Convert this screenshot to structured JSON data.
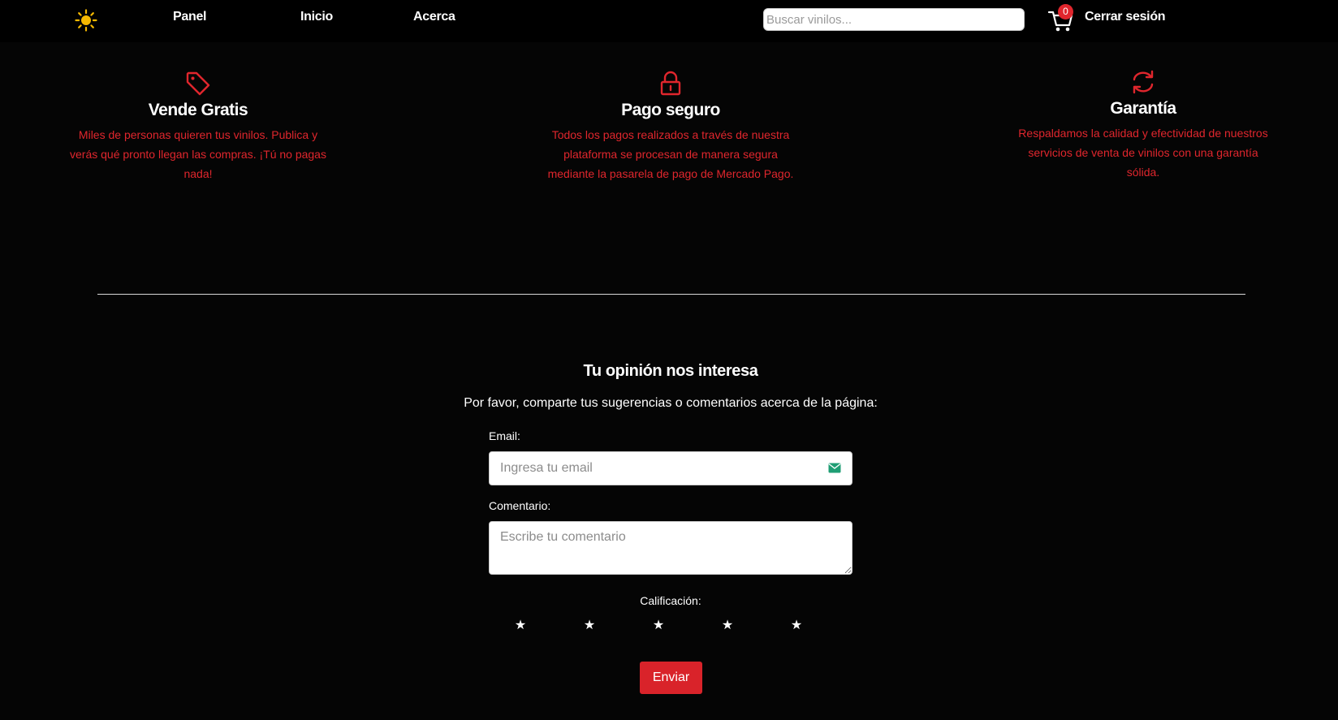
{
  "navbar": {
    "theme_icon": "sun-icon",
    "links": [
      "Panel",
      "Inicio",
      "Acerca"
    ],
    "search_placeholder": "Buscar vinilos...",
    "cart_icon": "shopping-cart-icon",
    "cart_count": "0",
    "logout_label": "Cerrar sesión"
  },
  "features": [
    {
      "icon": "tag-icon",
      "title": "Vende Gratis",
      "text": "Miles de personas quieren tus vinilos. Publica y verás qué pronto llegan las compras. ¡Tú no pagas nada!"
    },
    {
      "icon": "lock-icon",
      "title": "Pago seguro",
      "text": "Todos los pagos realizados a través de nuestra plataforma se procesan de manera segura mediante la pasarela de pago de Mercado Pago."
    },
    {
      "icon": "refresh-icon",
      "title": "Garantía",
      "text": "Respaldamos la calidad y efectividad de nuestros servicios de venta de vinilos con una garantía sólida."
    }
  ],
  "feedback": {
    "title": "Tu opinión nos interesa",
    "subtitle": "Por favor, comparte tus sugerencias o comentarios acerca de la página:",
    "email_label": "Email:",
    "email_placeholder": "Ingresa tu email",
    "email_icon": "envelope-icon",
    "comment_label": "Comentario:",
    "comment_placeholder": "Escribe tu comentario",
    "rating_label": "Calificación:",
    "stars": [
      "★",
      "★",
      "★",
      "★",
      "★"
    ],
    "rating_value": 0,
    "submit_label": "Enviar"
  },
  "colors": {
    "background": "#050505",
    "accent_red": "#e0262d",
    "sun_yellow": "#f5b800",
    "envelope_green": "#1f9e74"
  }
}
